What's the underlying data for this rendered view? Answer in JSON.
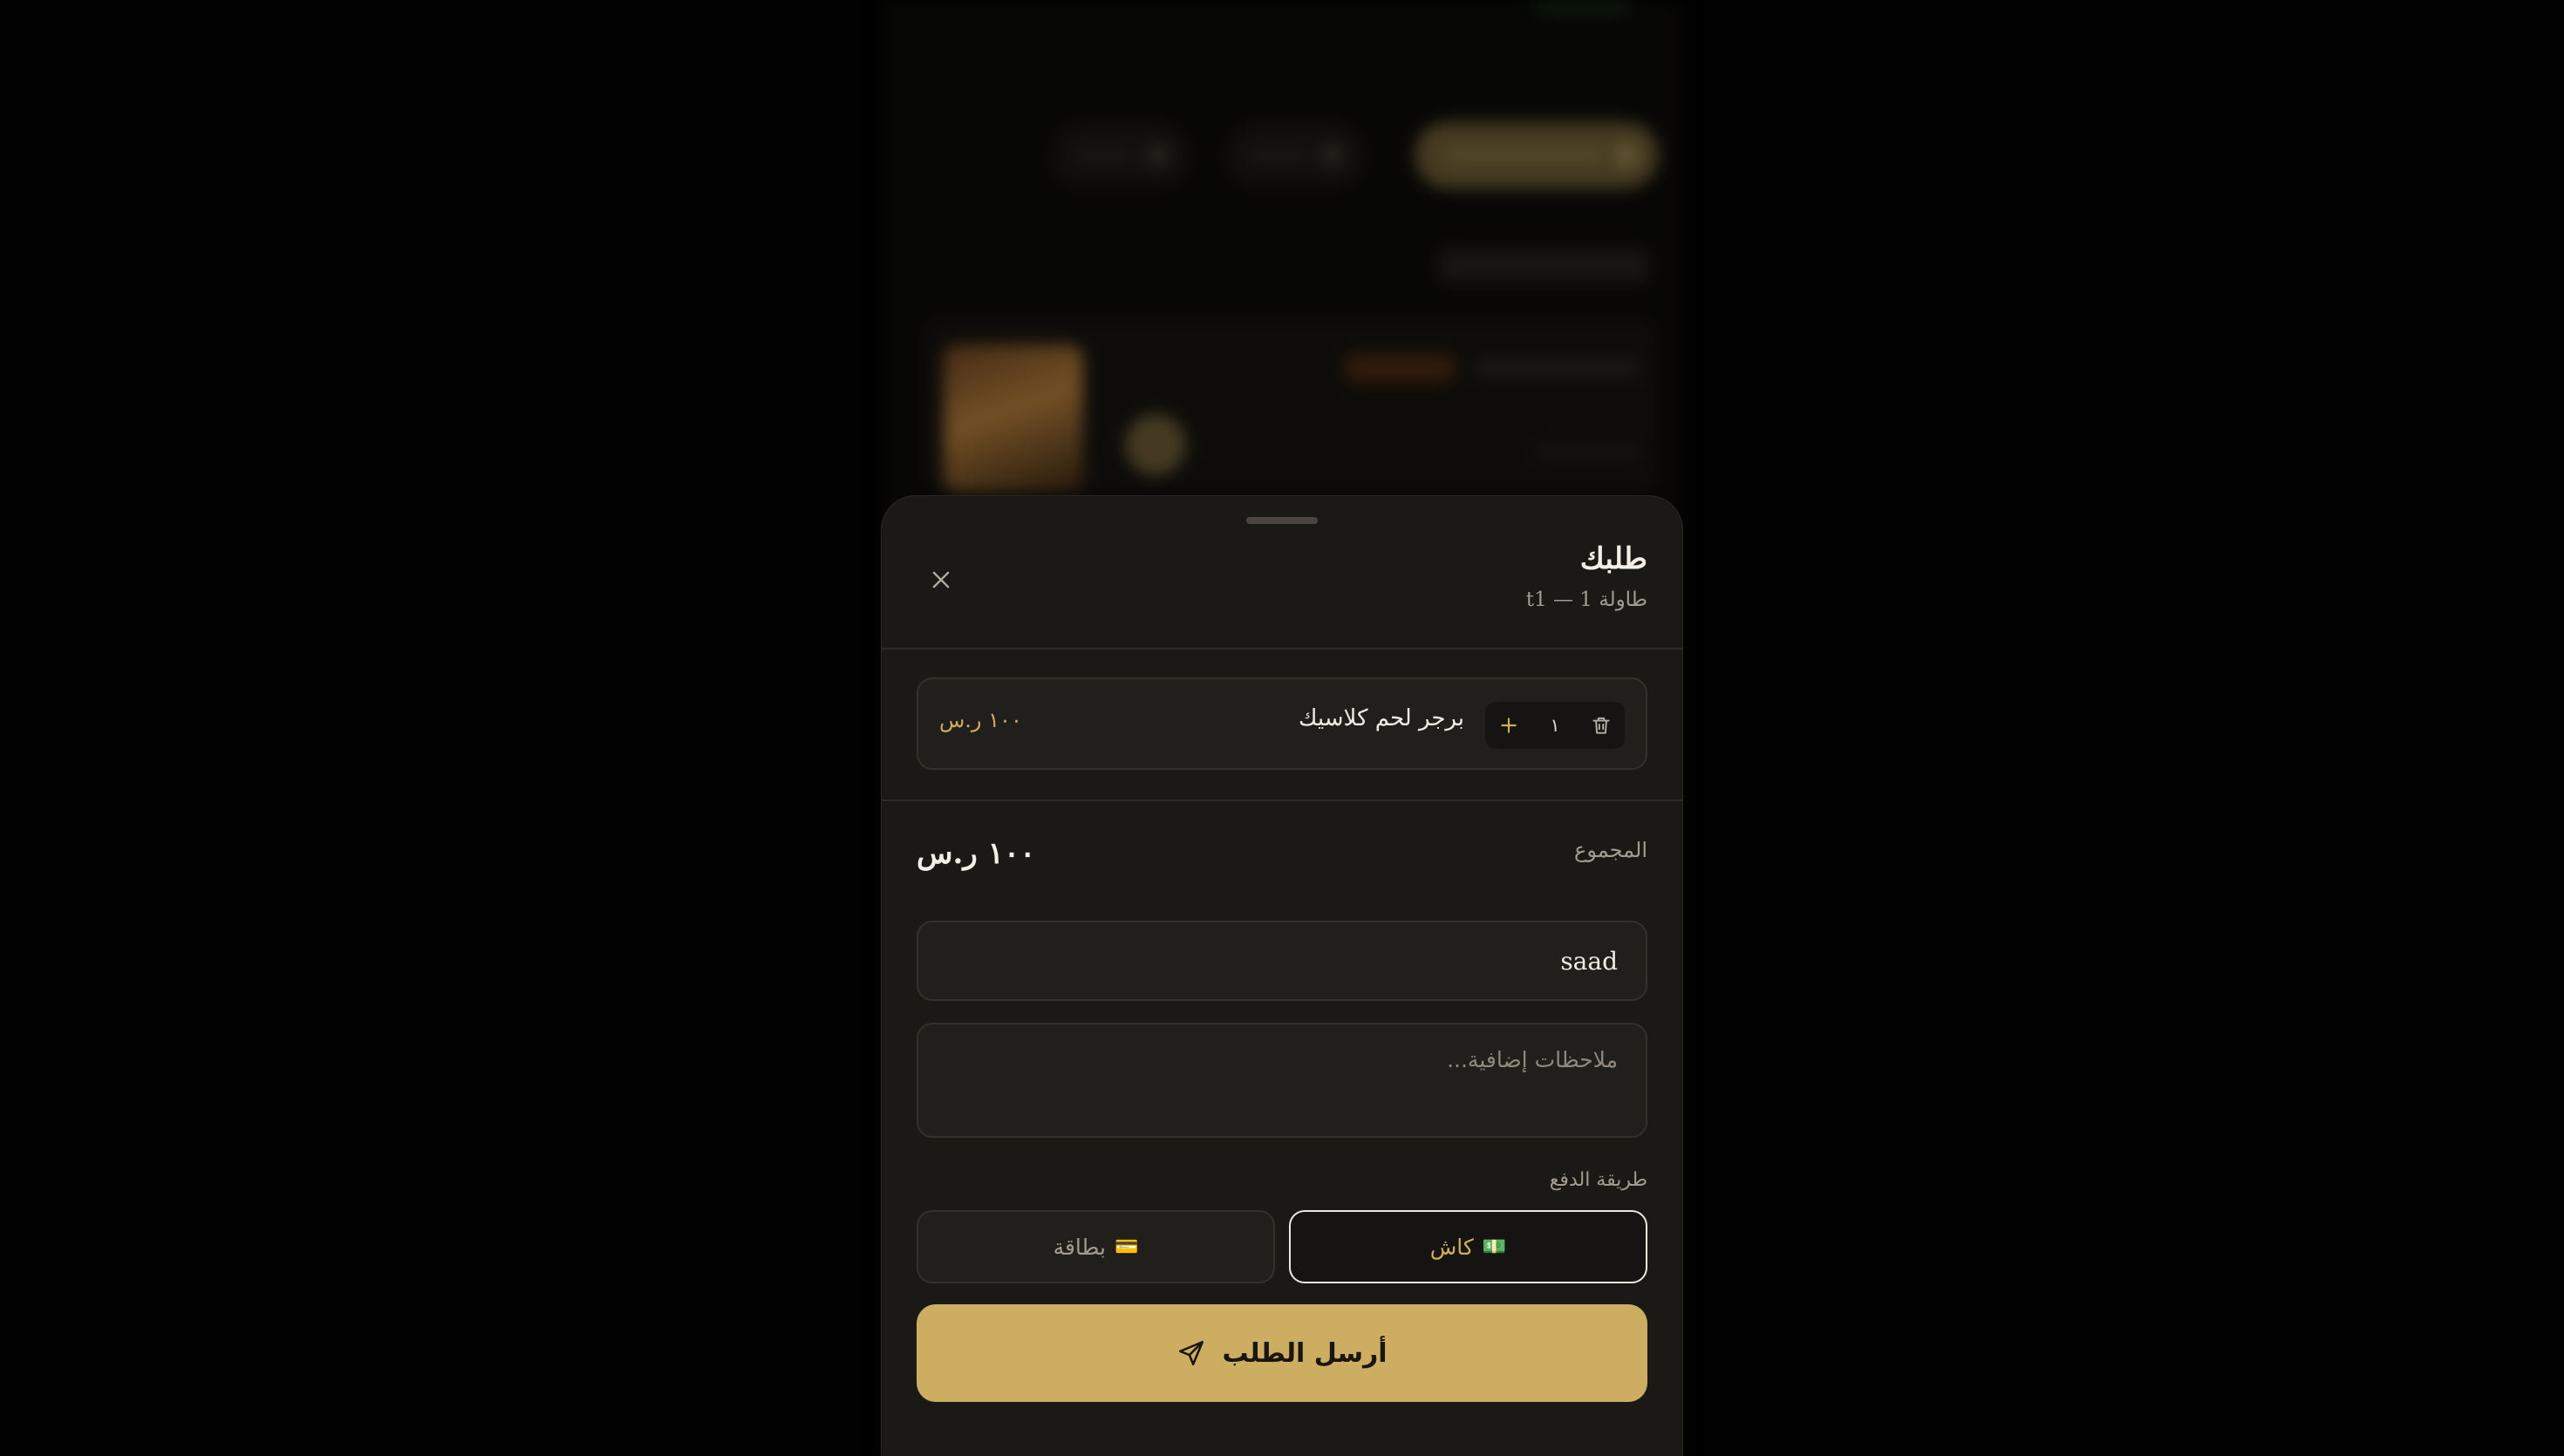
{
  "order_sheet": {
    "title": "طلبك",
    "subtitle": "طاولة 1 — t1",
    "items": [
      {
        "name": "برجر لحم كلاسيك",
        "quantity": "١",
        "price": "١٠٠ ر.س"
      }
    ],
    "total_label": "المجموع",
    "total_value": "١٠٠ ر.س",
    "customer_name_value": "saad",
    "notes_placeholder": "ملاحظات إضافية...",
    "payment_label": "طريقة الدفع",
    "payment_options": [
      {
        "emoji": "💵",
        "label": "كاش",
        "selected": true
      },
      {
        "emoji": "💳",
        "label": "بطاقة",
        "selected": false
      }
    ],
    "submit_label": "أرسل الطلب"
  },
  "colors": {
    "accent_gold": "#cdad62",
    "price_gold": "#d0ac5c",
    "sheet_bg": "#1b1916",
    "page_bg": "#020202"
  },
  "icons": {
    "close": "close-icon",
    "plus": "plus-icon",
    "trash": "trash-icon",
    "send": "send-icon"
  }
}
